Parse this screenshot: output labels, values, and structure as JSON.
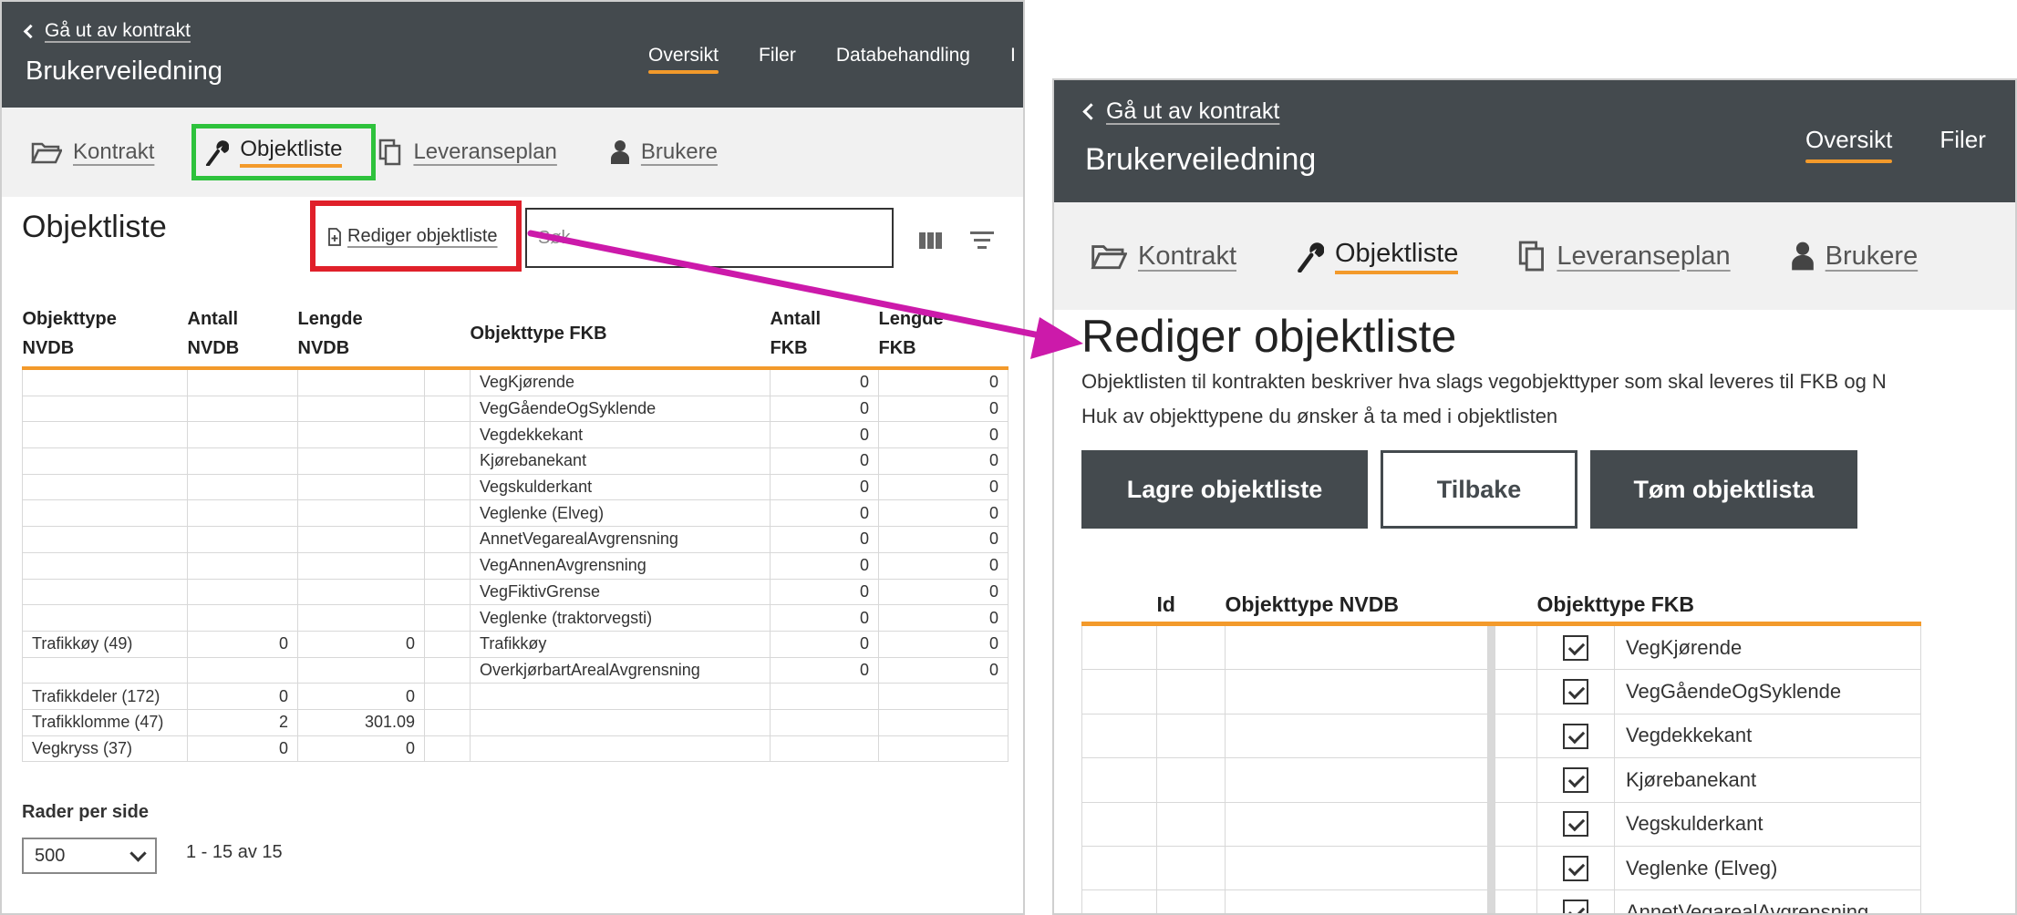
{
  "header": {
    "back_label": "Gå ut av kontrakt",
    "app_title": "Brukerveiledning",
    "nav": [
      {
        "label": "Oversikt",
        "active": true
      },
      {
        "label": "Filer",
        "active": false
      },
      {
        "label": "Databehandling",
        "active": false
      },
      {
        "label": "I",
        "active": false
      }
    ]
  },
  "tabs": [
    {
      "label": "Kontrakt",
      "icon": "folder-icon"
    },
    {
      "label": "Objektliste",
      "icon": "wrench-icon",
      "active": true
    },
    {
      "label": "Leveranseplan",
      "icon": "documents-icon"
    },
    {
      "label": "Brukere",
      "icon": "user-icon"
    }
  ],
  "objektliste": {
    "title": "Objektliste",
    "edit_label": "Rediger objektliste",
    "search_placeholder": "Søk",
    "columns": [
      "Objekttype NVDB",
      "Antall NVDB",
      "Lengde NVDB",
      "",
      "Objekttype FKB",
      "Antall FKB",
      "Lengde FKB"
    ],
    "rows": [
      [
        "",
        "",
        "",
        "",
        "VegKjørende",
        "0",
        "0"
      ],
      [
        "",
        "",
        "",
        "",
        "VegGåendeOgSyklende",
        "0",
        "0"
      ],
      [
        "",
        "",
        "",
        "",
        "Vegdekkekant",
        "0",
        "0"
      ],
      [
        "",
        "",
        "",
        "",
        "Kjørebanekant",
        "0",
        "0"
      ],
      [
        "",
        "",
        "",
        "",
        "Vegskulderkant",
        "0",
        "0"
      ],
      [
        "",
        "",
        "",
        "",
        "Veglenke (Elveg)",
        "0",
        "0"
      ],
      [
        "",
        "",
        "",
        "",
        "AnnetVegarealAvgrensning",
        "0",
        "0"
      ],
      [
        "",
        "",
        "",
        "",
        "VegAnnenAvgrensning",
        "0",
        "0"
      ],
      [
        "",
        "",
        "",
        "",
        "VegFiktivGrense",
        "0",
        "0"
      ],
      [
        "",
        "",
        "",
        "",
        "Veglenke (traktorvegsti)",
        "0",
        "0"
      ],
      [
        "Trafikkøy (49)",
        "0",
        "0",
        "",
        "Trafikkøy",
        "0",
        "0"
      ],
      [
        "",
        "",
        "",
        "",
        "OverkjørbartArealAvgrensning",
        "0",
        "0"
      ],
      [
        "Trafikkdeler (172)",
        "0",
        "0",
        "",
        "",
        "",
        ""
      ],
      [
        "Trafikklomme (47)",
        "2",
        "301.09",
        "",
        "",
        "",
        ""
      ],
      [
        "Vegkryss (37)",
        "0",
        "0",
        "",
        "",
        "",
        ""
      ]
    ],
    "rows_per_page_label": "Rader per side",
    "rows_per_page_value": "500",
    "pagination": "1 - 15 av 15"
  },
  "edit_view": {
    "header_nav": [
      {
        "label": "Oversikt",
        "active": true
      },
      {
        "label": "Filer",
        "active": false
      }
    ],
    "title": "Rediger objektliste",
    "desc_line1": "Objektlisten til kontrakten beskriver hva slags vegobjekttyper som skal leveres til FKB og N",
    "desc_line2": "Huk av objekttypene du ønsker å ta med i objektlisten",
    "buttons": {
      "save": "Lagre objektliste",
      "back": "Tilbake",
      "clear": "Tøm objektlista"
    },
    "columns": {
      "id": "Id",
      "nvdb": "Objekttype NVDB",
      "fkb": "Objekttype FKB"
    },
    "rows": [
      "VegKjørende",
      "VegGåendeOgSyklende",
      "Vegdekkekant",
      "Kjørebanekant",
      "Vegskulderkant",
      "Veglenke (Elveg)",
      "AnnetVegarealAvgrensning"
    ]
  },
  "colors": {
    "accent": "#f39a2b",
    "header_bg": "#444a4e",
    "highlight_green": "#2ec23c",
    "highlight_red": "#e0202a",
    "arrow": "#cc1aaa"
  }
}
